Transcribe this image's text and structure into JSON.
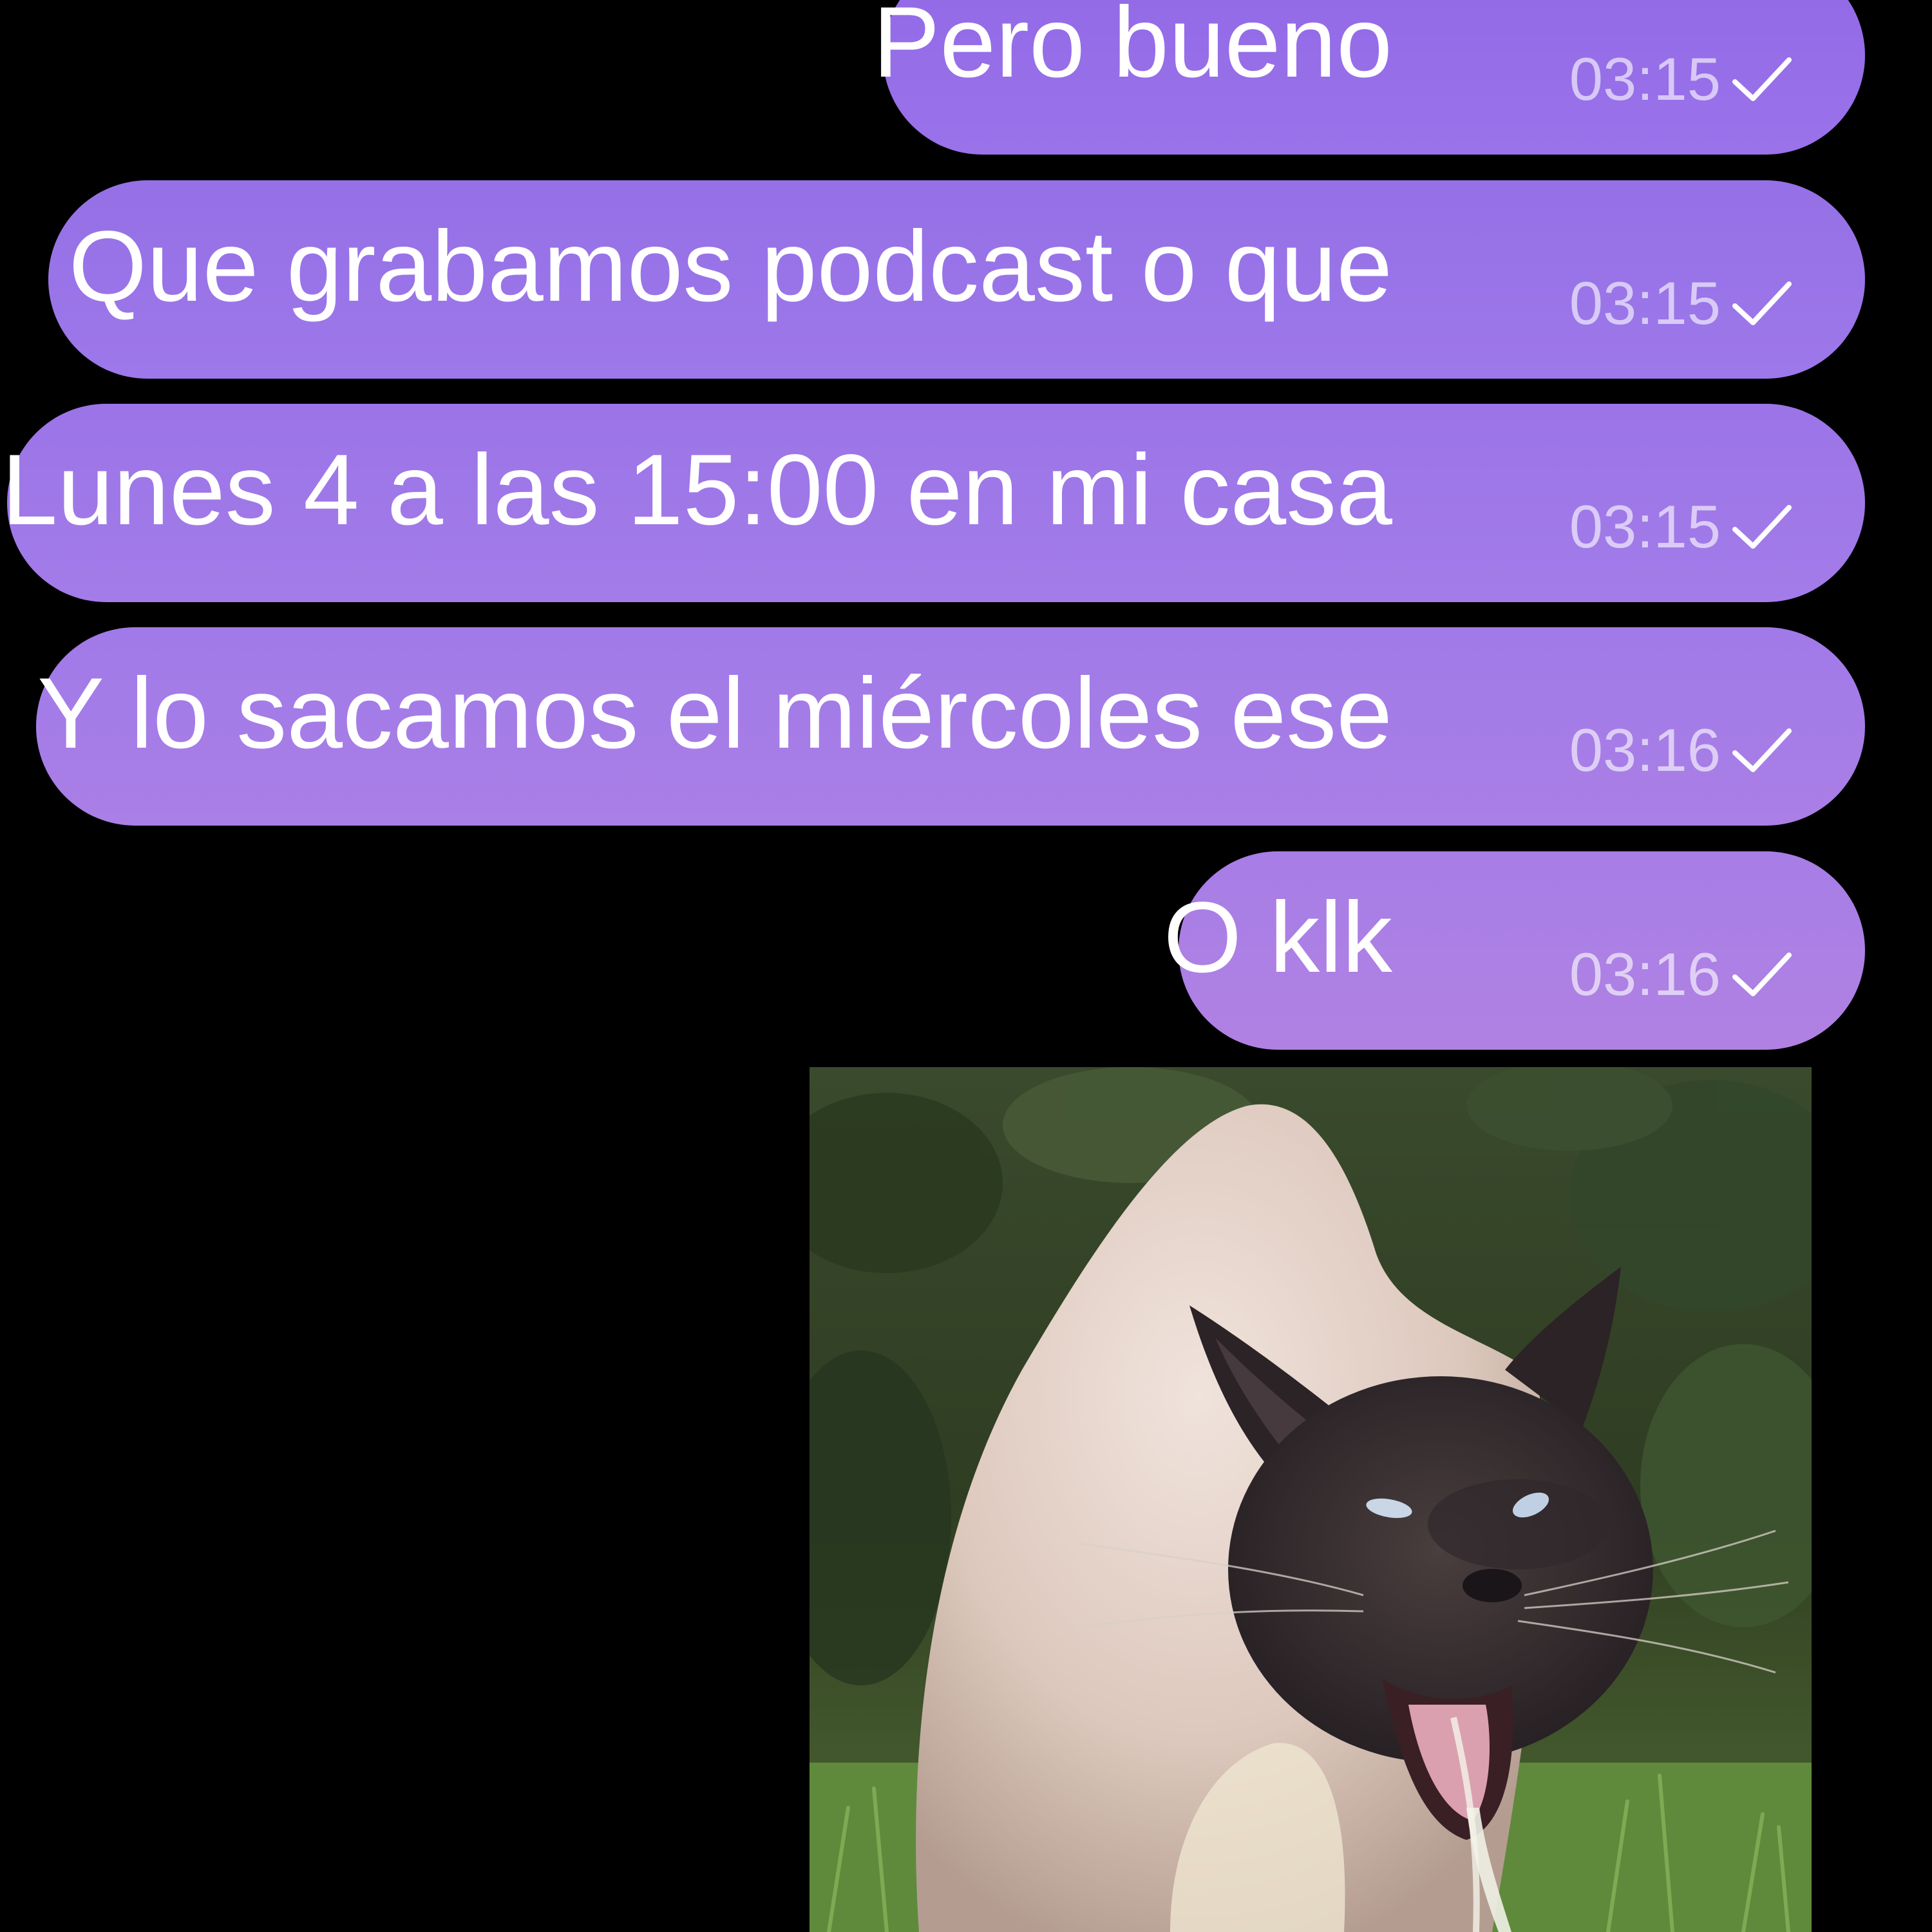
{
  "conversation": {
    "messages": [
      {
        "text": "Pero bueno",
        "time": "03:15",
        "status_icon": "sent-check-icon"
      },
      {
        "text": "Que grabamos podcast o que",
        "time": "03:15",
        "status_icon": "sent-check-icon"
      },
      {
        "text": "Lunes 4 a las 15:00 en mi casa",
        "time": "03:15",
        "status_icon": "sent-check-icon"
      },
      {
        "text": "Y lo sacamos el miércoles ese",
        "time": "03:16",
        "status_icon": "sent-check-icon"
      },
      {
        "text": "O klk",
        "time": "03:16",
        "status_icon": "sent-check-icon"
      }
    ],
    "attachment": {
      "kind": "photo",
      "subject": "siamese-cat"
    }
  },
  "colors": {
    "background": "#000000",
    "bubble_top": "#9169e6",
    "bubble_bottom": "#b081e3",
    "text": "#ffffff"
  }
}
